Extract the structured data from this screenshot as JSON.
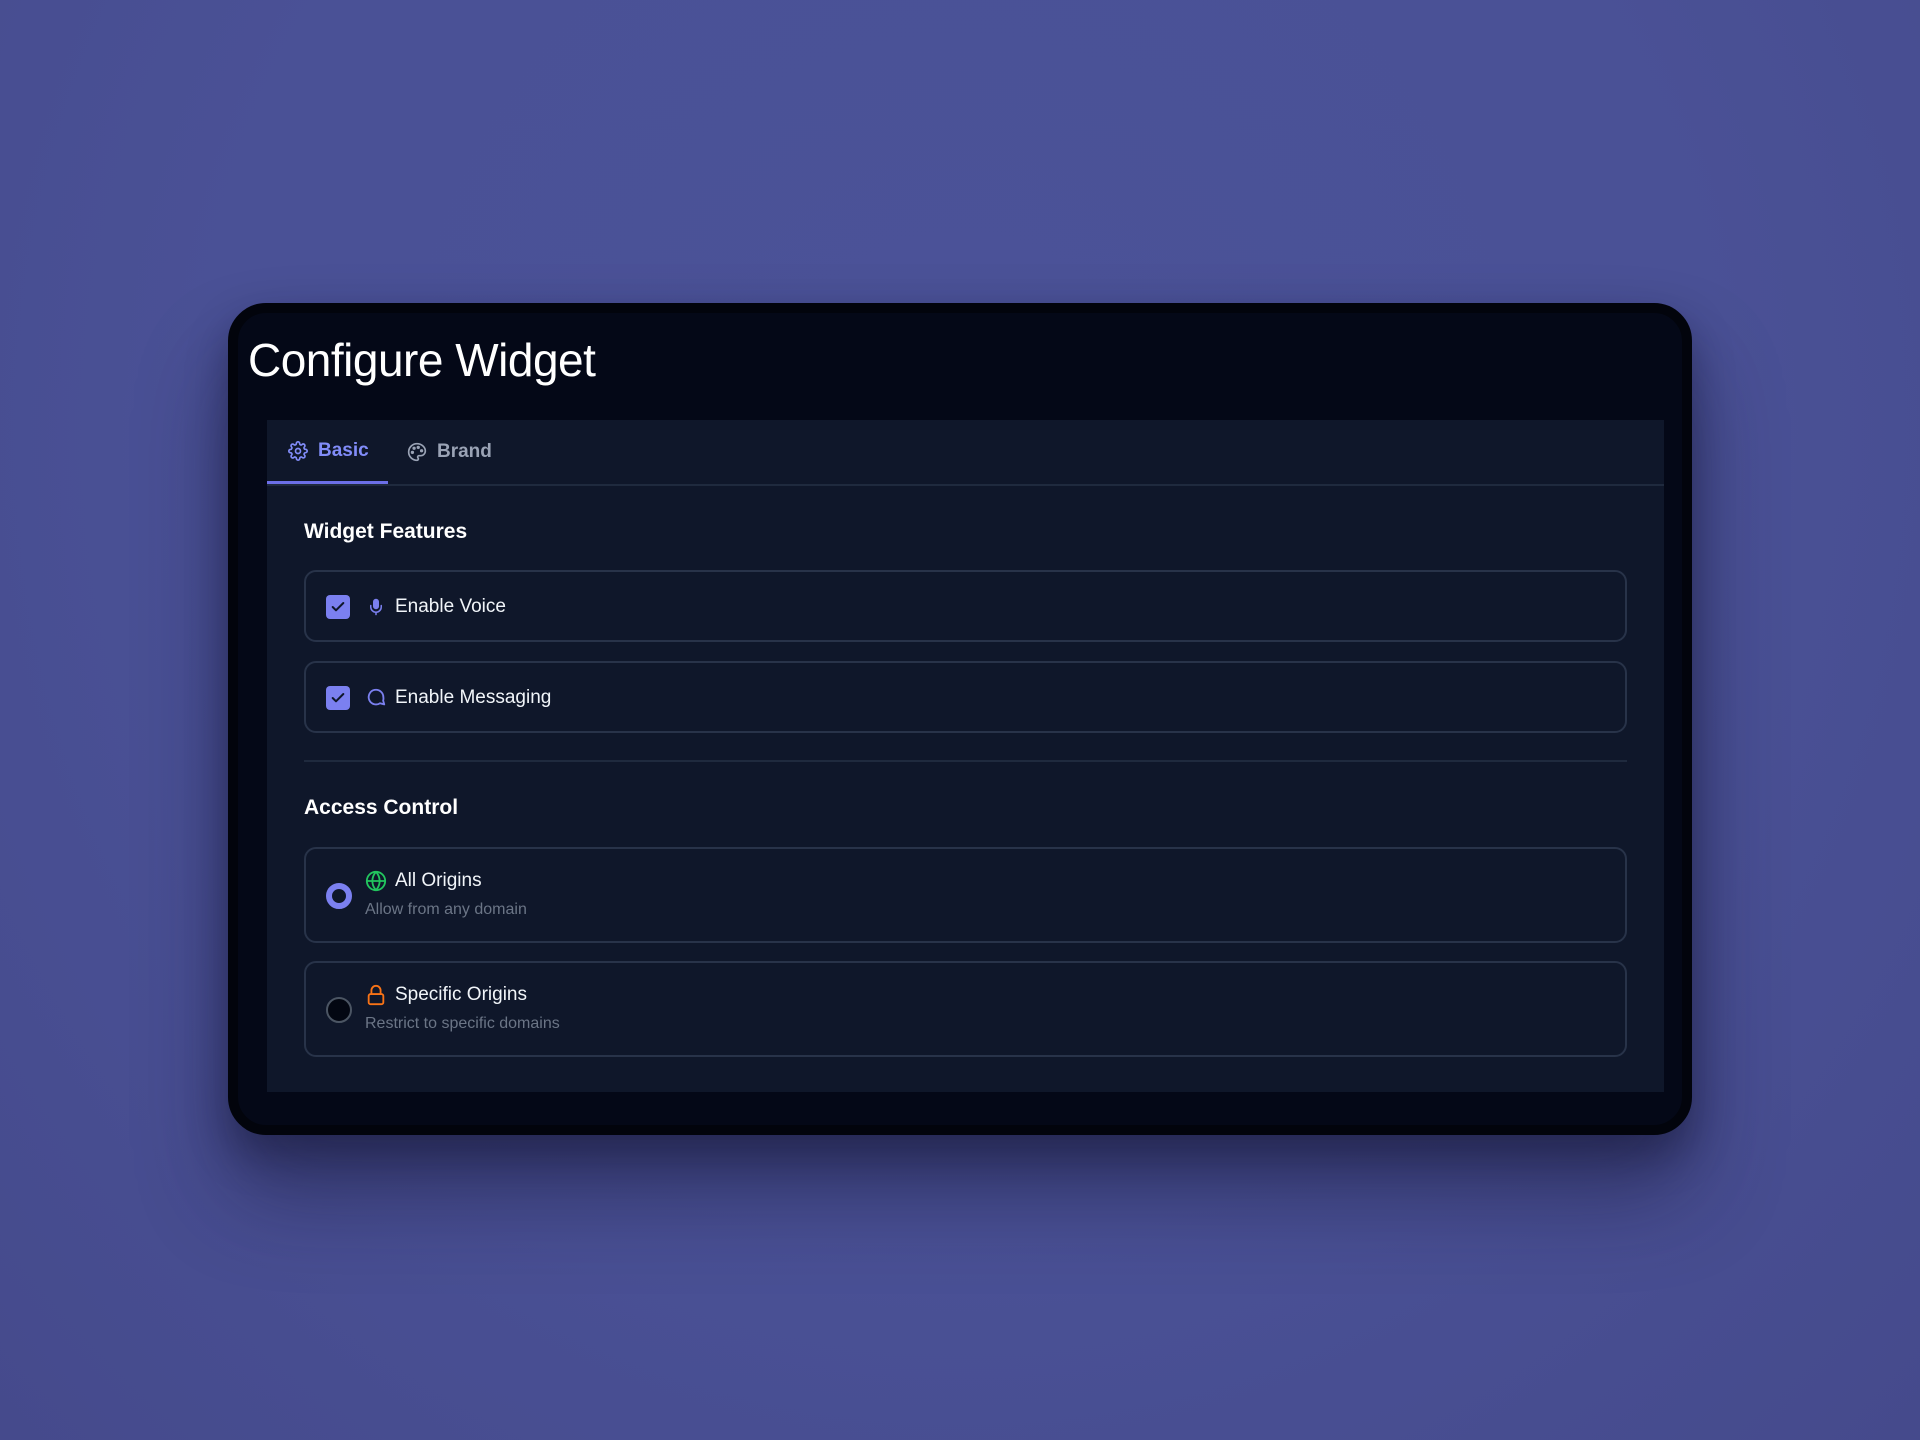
{
  "page": {
    "title": "Configure Widget"
  },
  "tabs": [
    {
      "label": "Basic",
      "icon": "gear-icon",
      "active": true
    },
    {
      "label": "Brand",
      "icon": "palette-icon",
      "active": false
    }
  ],
  "features": {
    "title": "Widget Features",
    "items": [
      {
        "label": "Enable Voice",
        "icon": "microphone-icon",
        "checked": true
      },
      {
        "label": "Enable Messaging",
        "icon": "chat-bubble-icon",
        "checked": true
      }
    ]
  },
  "access": {
    "title": "Access Control",
    "options": [
      {
        "label": "All Origins",
        "description": "Allow from any domain",
        "icon": "globe-icon",
        "selected": true
      },
      {
        "label": "Specific Origins",
        "description": "Restrict to specific domains",
        "icon": "lock-icon",
        "selected": false
      }
    ]
  },
  "colors": {
    "background": "#4b5298",
    "window": "#040817",
    "panel": "#0f172a",
    "accent": "#7b80f0",
    "tab_active": "#818cf8",
    "globe": "#22c55e",
    "lock": "#f97316"
  }
}
